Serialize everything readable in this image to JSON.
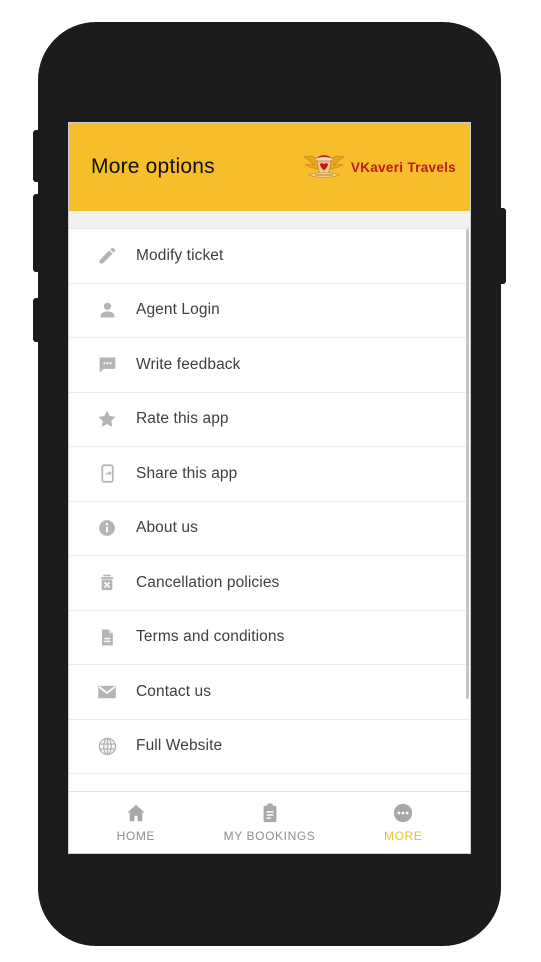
{
  "app": {
    "header": {
      "title": "More options",
      "brand_name": "VKaveri Travels",
      "brand_color": "#c01818",
      "background_color": "#f7be2c"
    }
  },
  "menu": {
    "items": [
      {
        "label": "Modify ticket",
        "icon": "pencil-icon"
      },
      {
        "label": "Agent Login",
        "icon": "person-icon"
      },
      {
        "label": "Write feedback",
        "icon": "chat-bubble-icon"
      },
      {
        "label": "Rate this app",
        "icon": "star-icon"
      },
      {
        "label": "Share this app",
        "icon": "phone-share-icon"
      },
      {
        "label": "About us",
        "icon": "info-circle-icon"
      },
      {
        "label": "Cancellation policies",
        "icon": "trash-x-icon"
      },
      {
        "label": "Terms and conditions",
        "icon": "document-icon"
      },
      {
        "label": "Contact us",
        "icon": "envelope-icon"
      },
      {
        "label": "Full Website",
        "icon": "globe-icon"
      }
    ]
  },
  "bottom_nav": {
    "items": [
      {
        "label": "HOME",
        "icon": "home-icon",
        "active": false
      },
      {
        "label": "MY BOOKINGS",
        "icon": "clipboard-icon",
        "active": false
      },
      {
        "label": "MORE",
        "icon": "more-dots-icon",
        "active": true
      }
    ],
    "active_color": "#f3bb32",
    "inactive_color": "#8e8e8e"
  }
}
